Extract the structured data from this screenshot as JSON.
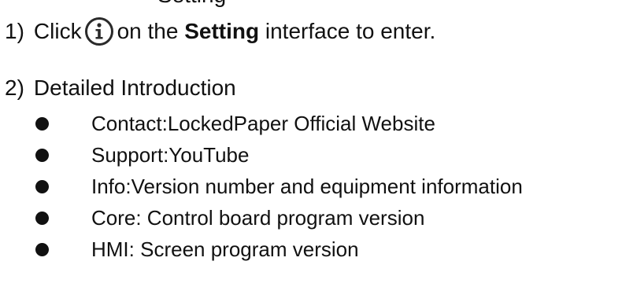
{
  "header_fragment": "Setting",
  "step1": {
    "number": "1)",
    "before_icon": "Click",
    "icon": "info-icon",
    "text_after_icon": "on the",
    "bold_word": "Setting",
    "text_end": "interface to enter."
  },
  "step2": {
    "number": "2)",
    "title": "Detailed Introduction"
  },
  "bullets": [
    {
      "text": "Contact:LockedPaper Official Website"
    },
    {
      "text": "Support:YouTube"
    },
    {
      "text": "Info:Version number and equipment information"
    },
    {
      "text": "Core: Control board program version"
    },
    {
      "text": "HMI: Screen program version"
    }
  ]
}
